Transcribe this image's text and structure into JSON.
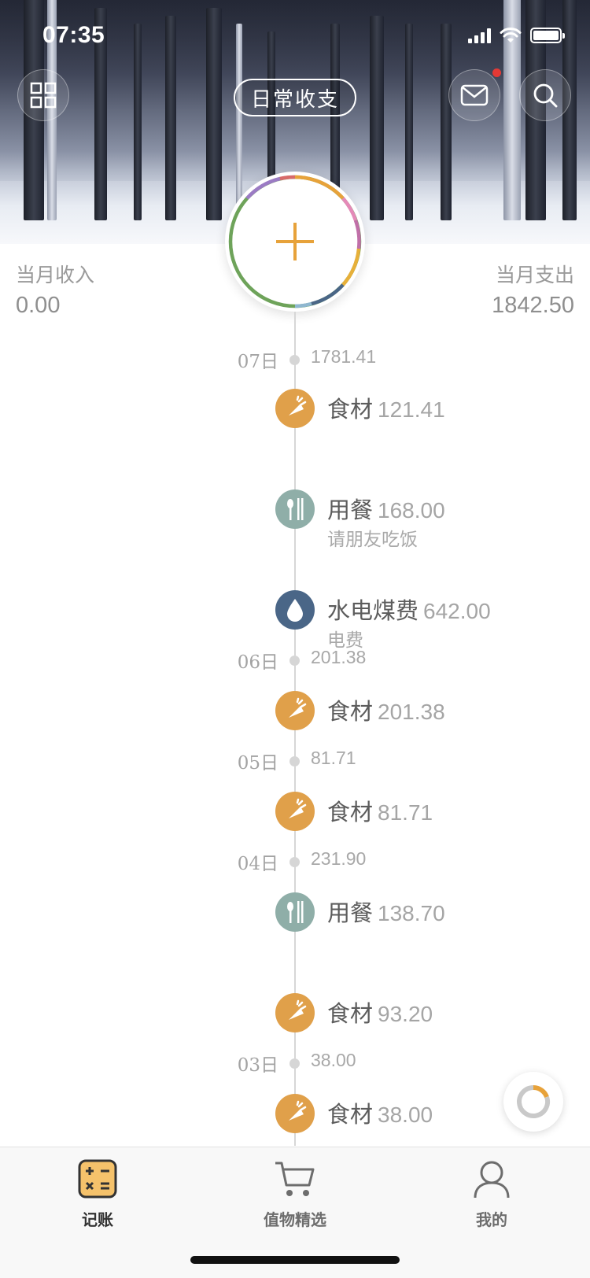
{
  "status": {
    "time": "07:35"
  },
  "header": {
    "tab_label": "日常收支"
  },
  "summary": {
    "income_label": "当月收入",
    "income_value": "0.00",
    "expense_label": "当月支出",
    "expense_value": "1842.50"
  },
  "colors": {
    "accent": "#E7A23A",
    "food": "#E0A04A",
    "dining": "#8FAEA8",
    "utilities": "#4A6687",
    "timeline": "#D7D7D7"
  },
  "days": [
    {
      "label": "07日",
      "total": "1781.41"
    },
    {
      "label": "06日",
      "total": "201.38"
    },
    {
      "label": "05日",
      "total": "81.71"
    },
    {
      "label": "04日",
      "total": "231.90"
    },
    {
      "label": "03日",
      "total": "38.00"
    }
  ],
  "entries": [
    {
      "category": "食材",
      "amount": "121.41",
      "note": "",
      "icon": "carrot-icon"
    },
    {
      "category": "用餐",
      "amount": "168.00",
      "note": "请朋友吃饭",
      "icon": "utensils-icon"
    },
    {
      "category": "水电煤费",
      "amount": "642.00",
      "note": "电费",
      "icon": "water-drop-icon"
    },
    {
      "category": "食材",
      "amount": "201.38",
      "note": "",
      "icon": "carrot-icon"
    },
    {
      "category": "食材",
      "amount": "81.71",
      "note": "",
      "icon": "carrot-icon"
    },
    {
      "category": "用餐",
      "amount": "138.70",
      "note": "",
      "icon": "utensils-icon"
    },
    {
      "category": "食材",
      "amount": "93.20",
      "note": "",
      "icon": "carrot-icon"
    },
    {
      "category": "食材",
      "amount": "38.00",
      "note": "",
      "icon": "carrot-icon"
    }
  ],
  "tabbar": {
    "items": [
      {
        "label": "记账",
        "icon": "calculator-icon",
        "active": true
      },
      {
        "label": "值物精选",
        "icon": "cart-icon",
        "active": false
      },
      {
        "label": "我的",
        "icon": "user-icon",
        "active": false
      }
    ]
  }
}
